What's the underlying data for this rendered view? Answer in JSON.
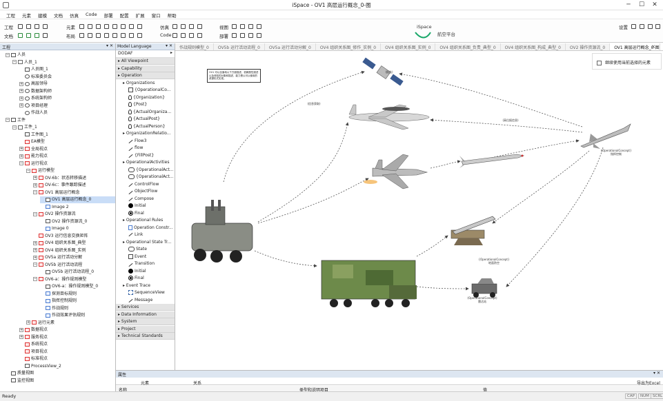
{
  "window": {
    "title": "iSpace - OV1 高层运行概念_0-图",
    "min": "─",
    "max": "☐",
    "close": "✕"
  },
  "menu": [
    "工程",
    "元素",
    "建模",
    "文档",
    "仿真",
    "Code",
    "部署",
    "配置",
    "扩展",
    "窗口",
    "帮助"
  ],
  "ribbon": {
    "row1": [
      "工程",
      "元素",
      "仿真",
      "视图",
      "设置"
    ],
    "row2": [
      "文档",
      "布局",
      "Code",
      "部署"
    ],
    "logo_top": "iSpace",
    "logo_sub": "航空平台"
  },
  "left_panel": {
    "title": "工程",
    "tree": [
      {
        "t": "人员",
        "lv": 0,
        "ex": "−",
        "ic": "diag"
      },
      {
        "t": "人员_1",
        "lv": 1,
        "ex": "−",
        "ic": "fol"
      },
      {
        "t": "人员图_1",
        "lv": 2,
        "ex": "",
        "ic": "diag"
      },
      {
        "t": "标准委员会",
        "lv": 2,
        "ex": "",
        "ic": "per"
      },
      {
        "t": "高层领导",
        "lv": 2,
        "ex": "+",
        "ic": "per"
      },
      {
        "t": "数据架构师",
        "lv": 2,
        "ex": "+",
        "ic": "per"
      },
      {
        "t": "系统架构师",
        "lv": 2,
        "ex": "+",
        "ic": "per"
      },
      {
        "t": "项目经理",
        "lv": 2,
        "ex": "+",
        "ic": "per"
      },
      {
        "t": "作战人员",
        "lv": 2,
        "ex": "",
        "ic": "per"
      },
      {
        "t": "工件",
        "lv": 0,
        "ex": "−",
        "ic": "diag"
      },
      {
        "t": "工件_1",
        "lv": 1,
        "ex": "−",
        "ic": "fol"
      },
      {
        "t": "工件图_1",
        "lv": 2,
        "ex": "",
        "ic": "diag"
      },
      {
        "t": "EA模型",
        "lv": 2,
        "ex": "",
        "ic": "red"
      },
      {
        "t": "全局视点",
        "lv": 2,
        "ex": "+",
        "ic": "red"
      },
      {
        "t": "能力视点",
        "lv": 2,
        "ex": "+",
        "ic": "red"
      },
      {
        "t": "运行视点",
        "lv": 2,
        "ex": "−",
        "ic": "red"
      },
      {
        "t": "运行模型",
        "lv": 3,
        "ex": "−",
        "ic": "red"
      },
      {
        "t": "OV-6b：状态转移描述",
        "lv": 4,
        "ex": "+",
        "ic": "red"
      },
      {
        "t": "OV-6c：事件跟踪描述",
        "lv": 4,
        "ex": "+",
        "ic": "red"
      },
      {
        "t": "OV1 高层运行概念",
        "lv": 4,
        "ex": "−",
        "ic": "red"
      },
      {
        "t": "OV1 高层运行概念_0",
        "lv": 5,
        "ex": "",
        "ic": "diag",
        "sel": true
      },
      {
        "t": "Image 2",
        "lv": 5,
        "ex": "",
        "ic": "doc"
      },
      {
        "t": "OV2 操作资源流",
        "lv": 4,
        "ex": "−",
        "ic": "red"
      },
      {
        "t": "OV2 操作资源流_0",
        "lv": 5,
        "ex": "",
        "ic": "diag"
      },
      {
        "t": "Image 0",
        "lv": 5,
        "ex": "",
        "ic": "doc"
      },
      {
        "t": "OV3 运行信息交换矩阵",
        "lv": 4,
        "ex": "",
        "ic": "red"
      },
      {
        "t": "OV4 组织关系图_典型",
        "lv": 4,
        "ex": "+",
        "ic": "red"
      },
      {
        "t": "OV4 组织关系图_实例",
        "lv": 4,
        "ex": "+",
        "ic": "red"
      },
      {
        "t": "OV5a 运行活动分解",
        "lv": 4,
        "ex": "+",
        "ic": "red"
      },
      {
        "t": "OV5b 运行活动流程",
        "lv": 4,
        "ex": "−",
        "ic": "red"
      },
      {
        "t": "OV5b 运行活动流程_0",
        "lv": 5,
        "ex": "",
        "ic": "diag"
      },
      {
        "t": "OV6-a：操作规则模型",
        "lv": 4,
        "ex": "−",
        "ic": "red"
      },
      {
        "t": "OV6-a：操作规则模型_0",
        "lv": 5,
        "ex": "",
        "ic": "diag"
      },
      {
        "t": "探测目标规则",
        "lv": 5,
        "ex": "",
        "ic": "doc"
      },
      {
        "t": "指挥控制规则",
        "lv": 5,
        "ex": "",
        "ic": "doc"
      },
      {
        "t": "作战规则",
        "lv": 5,
        "ex": "",
        "ic": "doc"
      },
      {
        "t": "作战效果评估规则",
        "lv": 5,
        "ex": "",
        "ic": "doc"
      },
      {
        "t": "运行元素",
        "lv": 3,
        "ex": "+",
        "ic": "red"
      },
      {
        "t": "数据视点",
        "lv": 2,
        "ex": "+",
        "ic": "red"
      },
      {
        "t": "服务视点",
        "lv": 2,
        "ex": "+",
        "ic": "red"
      },
      {
        "t": "系统视点",
        "lv": 2,
        "ex": "",
        "ic": "red"
      },
      {
        "t": "项目视点",
        "lv": 2,
        "ex": "",
        "ic": "red"
      },
      {
        "t": "标准视点",
        "lv": 2,
        "ex": "",
        "ic": "red"
      },
      {
        "t": "ProcessView_2",
        "lv": 2,
        "ex": "",
        "ic": "diag"
      },
      {
        "t": "质量视图",
        "lv": 0,
        "ex": "",
        "ic": "diag"
      },
      {
        "t": "监控视图",
        "lv": 0,
        "ex": "",
        "ic": "diag"
      }
    ]
  },
  "model_panel": {
    "title": "Model Language",
    "lang": "DODAF",
    "items": [
      {
        "t": "All Viewpoint",
        "k": "cat"
      },
      {
        "t": "Capability",
        "k": "cat"
      },
      {
        "t": "Operation",
        "k": "cat"
      },
      {
        "t": "Organizations",
        "k": "sub"
      },
      {
        "t": "{OperationalCo...",
        "k": "it",
        "ic": "box"
      },
      {
        "t": "{Organization}",
        "k": "it",
        "ic": "per"
      },
      {
        "t": "{Post}",
        "k": "it",
        "ic": "per"
      },
      {
        "t": "{ActualOrganiza...",
        "k": "it",
        "ic": "per"
      },
      {
        "t": "{ActualPost}",
        "k": "it",
        "ic": "per"
      },
      {
        "t": "{ActualPerson}",
        "k": "it",
        "ic": "per"
      },
      {
        "t": "OrganizationRelatio...",
        "k": "sub"
      },
      {
        "t": "Flow3",
        "k": "it",
        "ic": "arr"
      },
      {
        "t": "flow",
        "k": "it",
        "ic": "arr"
      },
      {
        "t": "{FillPost}",
        "k": "it",
        "ic": "arr"
      },
      {
        "t": "OperationalActivities",
        "k": "sub"
      },
      {
        "t": "{OperationalAct...",
        "k": "it",
        "ic": "rnd"
      },
      {
        "t": "{OperationalAct...",
        "k": "it",
        "ic": "rnd"
      },
      {
        "t": "ControlFlow",
        "k": "it",
        "ic": "arr"
      },
      {
        "t": "ObjectFlow",
        "k": "it",
        "ic": "arr"
      },
      {
        "t": "Compose",
        "k": "it",
        "ic": "arr"
      },
      {
        "t": "Initial",
        "k": "it",
        "ic": "dot"
      },
      {
        "t": "Final",
        "k": "it",
        "ic": "fin"
      },
      {
        "t": "Operational Rules",
        "k": "sub"
      },
      {
        "t": "Operation Constr...",
        "k": "it",
        "ic": "doc"
      },
      {
        "t": "Link",
        "k": "it",
        "ic": "lnk"
      },
      {
        "t": "Operational State Tr...",
        "k": "sub"
      },
      {
        "t": "State",
        "k": "it",
        "ic": "rnd"
      },
      {
        "t": "Event",
        "k": "it",
        "ic": "box"
      },
      {
        "t": "Transition",
        "k": "it",
        "ic": "arr"
      },
      {
        "t": "Initial",
        "k": "it",
        "ic": "dot"
      },
      {
        "t": "Final",
        "k": "it",
        "ic": "fin"
      },
      {
        "t": "Event Trace",
        "k": "sub"
      },
      {
        "t": "SequenceView",
        "k": "it",
        "ic": "seq"
      },
      {
        "t": "Message",
        "k": "it",
        "ic": "arr"
      },
      {
        "t": "Services",
        "k": "cat"
      },
      {
        "t": "Data Information",
        "k": "cat"
      },
      {
        "t": "System",
        "k": "cat"
      },
      {
        "t": "Project",
        "k": "cat"
      },
      {
        "t": "Technical Standards",
        "k": "cat"
      }
    ]
  },
  "doc_tabs": [
    "作战规则模型_0",
    "OV5b 运行活动流程_0",
    "OV5a 运行活动分解_0",
    "OV4 组织关系图_修作_实例_0",
    "OV4 组织关系图_实例_0",
    "OV4 组织关系图_负责_典型_0",
    "OV4 组织关系图_构成_典型_0",
    "OV2 操作资源流_0",
    "OV1 高层运行概念_0-图"
  ],
  "canvas": {
    "checkbox_label": "继续使用当前选择的元素",
    "note": "OV1 可以全面地以下方面描述，依赖属性描述以及体验的对象和描述，能力是以可以使用的资源形式实现。",
    "labels": [
      "(信息获取)",
      "(报告)",
      "(高位报信息)",
      "{OperationalConcept}\n指挥控制",
      "{OperationalConcept}\n地面防空",
      "(OperationalConcept)\n雷达站"
    ]
  },
  "properties": {
    "title": "属性",
    "tab1": "元素",
    "tab2": "关系",
    "export": "导出为Excel",
    "col1": "名称",
    "col2": "类型和说明项目",
    "col3": "值"
  },
  "status": {
    "ready": "Ready",
    "caps": "CAP",
    "num": "NUM",
    "scrl": "SCRL"
  },
  "colors": {
    "panel_header": "#dde6f1",
    "selection": "#c9ddf7",
    "logo": "#1aa86a"
  }
}
